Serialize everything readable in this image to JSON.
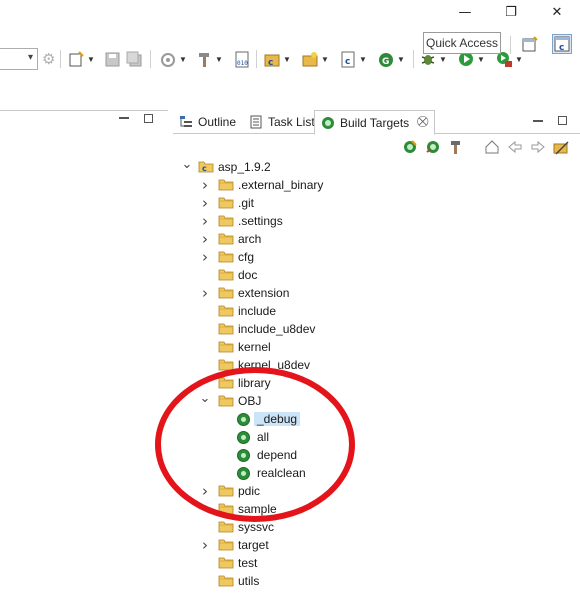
{
  "window": {
    "controls": [
      {
        "name": "minimize-button",
        "glyph": "—"
      },
      {
        "name": "restore-button",
        "glyph": "❐"
      },
      {
        "name": "close-button",
        "glyph": "✕"
      }
    ]
  },
  "toolbar": {
    "quick_access_label": "Quick Access"
  },
  "view": {
    "tabs": [
      {
        "label": "Outline",
        "icon": "outline-icon"
      },
      {
        "label": "Task List",
        "icon": "task-list-icon"
      },
      {
        "label": "Build Targets",
        "icon": "build-target-icon",
        "active": true
      }
    ],
    "close_glyph": "⛒"
  },
  "tree": {
    "project": "asp_1.9.2",
    "folders": [
      {
        "label": ".external_binary",
        "expandable": true
      },
      {
        "label": ".git",
        "expandable": true
      },
      {
        "label": ".settings",
        "expandable": true
      },
      {
        "label": "arch",
        "expandable": true
      },
      {
        "label": "cfg",
        "expandable": true
      },
      {
        "label": "doc",
        "expandable": false
      },
      {
        "label": "extension",
        "expandable": true
      },
      {
        "label": "include",
        "expandable": false
      },
      {
        "label": "include_u8dev",
        "expandable": false
      },
      {
        "label": "kernel",
        "expandable": false
      },
      {
        "label": "kernel_u8dev",
        "expandable": false
      },
      {
        "label": "library",
        "expandable": false
      },
      {
        "label": "OBJ",
        "expandable": true,
        "expanded": true
      }
    ],
    "targets": [
      {
        "label": "_debug",
        "selected": true
      },
      {
        "label": "all"
      },
      {
        "label": "depend"
      },
      {
        "label": "realclean"
      }
    ],
    "folders_after": [
      {
        "label": "pdic",
        "expandable": true
      },
      {
        "label": "sample",
        "expandable": false
      },
      {
        "label": "syssvc",
        "expandable": false
      },
      {
        "label": "target",
        "expandable": true
      },
      {
        "label": "test",
        "expandable": false
      },
      {
        "label": "utils",
        "expandable": false
      }
    ]
  },
  "colors": {
    "annotation": "#e4141b",
    "selection": "#cce4f7",
    "folder": "#e8b84a",
    "target_green": "#2e8b3a"
  }
}
